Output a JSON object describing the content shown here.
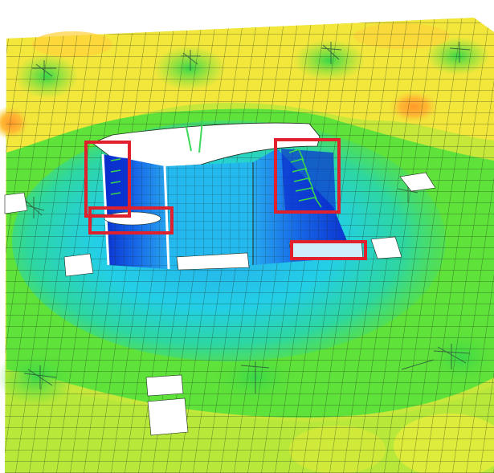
{
  "scene": {
    "kind": "finite-element slab contour plot",
    "colors": {
      "background": "#ffffff",
      "orange": "#ff9a2a",
      "yellow": "#f3e73c",
      "yellow_green": "#c6e83a",
      "green": "#5fe23a",
      "bright_green": "#38d84a",
      "teal": "#2ed7a0",
      "cyan": "#23cfe6",
      "light_blue": "#27a8ef",
      "blue": "#1768e8",
      "dark_blue": "#0a2ecf",
      "mesh": "#1b2a1b",
      "highlight_box": "#e0202c",
      "support_line": "#2f5a3a"
    }
  },
  "openings": [
    {
      "name": "opening-top-right"
    },
    {
      "name": "opening-left-edge"
    },
    {
      "name": "opening-lower-left"
    },
    {
      "name": "opening-core-bottom"
    },
    {
      "name": "opening-right"
    },
    {
      "name": "opening-bottom-a"
    },
    {
      "name": "opening-bottom-b"
    }
  ],
  "highlights": [
    {
      "name": "highlight-left-wall"
    },
    {
      "name": "highlight-left-base"
    },
    {
      "name": "highlight-right-wall"
    },
    {
      "name": "highlight-right-base"
    }
  ]
}
